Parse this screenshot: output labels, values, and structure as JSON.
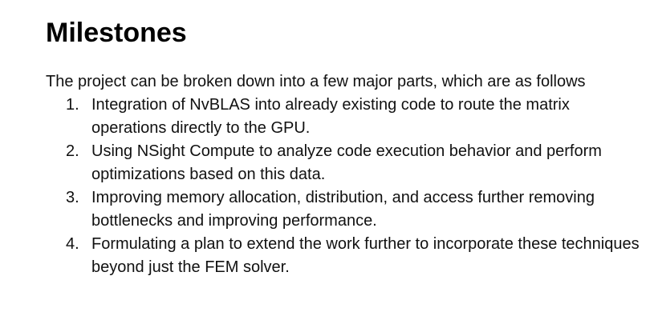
{
  "document": {
    "heading": "Milestones",
    "intro": "The project can be broken down into a few major parts, which are as follows",
    "milestones": [
      {
        "number": "1.",
        "text": "Integration of NvBLAS into already existing code to route the matrix operations directly to the GPU."
      },
      {
        "number": "2.",
        "text": "Using NSight Compute to analyze code execution behavior and perform optimizations based on this data."
      },
      {
        "number": "3.",
        "text": "Improving memory allocation, distribution, and access further removing bottlenecks and improving performance."
      },
      {
        "number": "4.",
        "text": "Formulating a plan to extend the work further to incorporate these techniques beyond just the FEM solver."
      }
    ]
  }
}
